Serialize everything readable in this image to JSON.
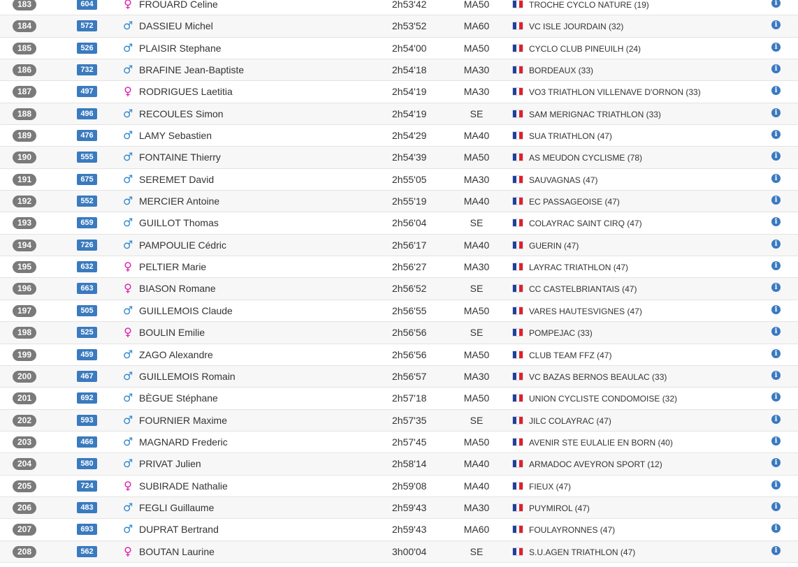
{
  "colors": {
    "rank_badge": "#7a7a7a",
    "bib_badge": "#3a7abf",
    "male_icon": "#2f87cf",
    "female_icon": "#e01aa8",
    "info_icon": "#3a7abf",
    "flag_blue": "#1f3fa0",
    "flag_white": "#ffffff",
    "flag_red": "#e0202c"
  },
  "icons": {
    "male": "male-icon",
    "female": "female-icon",
    "flag": "french-flag-icon",
    "info": "info-icon"
  },
  "results": [
    {
      "rank": "183",
      "bib": "604",
      "sex": "F",
      "name": "FROUARD Celine",
      "time": "2h53'42",
      "category": "MA50",
      "club": "TROCHE CYCLO NATURE (19)"
    },
    {
      "rank": "184",
      "bib": "572",
      "sex": "M",
      "name": "DASSIEU Michel",
      "time": "2h53'52",
      "category": "MA60",
      "club": "VC ISLE JOURDAIN (32)"
    },
    {
      "rank": "185",
      "bib": "526",
      "sex": "M",
      "name": "PLAISIR Stephane",
      "time": "2h54'00",
      "category": "MA50",
      "club": "CYCLO CLUB PINEUILH (24)"
    },
    {
      "rank": "186",
      "bib": "732",
      "sex": "M",
      "name": "BRAFINE Jean-Baptiste",
      "time": "2h54'18",
      "category": "MA30",
      "club": "BORDEAUX (33)"
    },
    {
      "rank": "187",
      "bib": "497",
      "sex": "F",
      "name": "RODRIGUES Laetitia",
      "time": "2h54'19",
      "category": "MA30",
      "club": "VO3 TRIATHLON VILLENAVE D'ORNON (33)"
    },
    {
      "rank": "188",
      "bib": "496",
      "sex": "M",
      "name": "RECOULES Simon",
      "time": "2h54'19",
      "category": "SE",
      "club": "SAM MERIGNAC TRIATHLON (33)"
    },
    {
      "rank": "189",
      "bib": "476",
      "sex": "M",
      "name": "LAMY Sebastien",
      "time": "2h54'29",
      "category": "MA40",
      "club": "SUA TRIATHLON (47)"
    },
    {
      "rank": "190",
      "bib": "555",
      "sex": "M",
      "name": "FONTAINE Thierry",
      "time": "2h54'39",
      "category": "MA50",
      "club": "AS MEUDON CYCLISME (78)"
    },
    {
      "rank": "191",
      "bib": "675",
      "sex": "M",
      "name": "SEREMET David",
      "time": "2h55'05",
      "category": "MA30",
      "club": "SAUVAGNAS (47)"
    },
    {
      "rank": "192",
      "bib": "552",
      "sex": "M",
      "name": "MERCIER Antoine",
      "time": "2h55'19",
      "category": "MA40",
      "club": "EC PASSAGEOISE (47)"
    },
    {
      "rank": "193",
      "bib": "659",
      "sex": "M",
      "name": "GUILLOT Thomas",
      "time": "2h56'04",
      "category": "SE",
      "club": "COLAYRAC SAINT CIRQ (47)"
    },
    {
      "rank": "194",
      "bib": "726",
      "sex": "M",
      "name": "PAMPOULIE Cédric",
      "time": "2h56'17",
      "category": "MA40",
      "club": "GUERIN (47)"
    },
    {
      "rank": "195",
      "bib": "632",
      "sex": "F",
      "name": "PELTIER Marie",
      "time": "2h56'27",
      "category": "MA30",
      "club": "LAYRAC TRIATHLON (47)"
    },
    {
      "rank": "196",
      "bib": "663",
      "sex": "F",
      "name": "BIASON Romane",
      "time": "2h56'52",
      "category": "SE",
      "club": "CC CASTELBRIANTAIS (47)"
    },
    {
      "rank": "197",
      "bib": "505",
      "sex": "M",
      "name": "GUILLEMOIS Claude",
      "time": "2h56'55",
      "category": "MA50",
      "club": "VARES HAUTESVIGNES (47)"
    },
    {
      "rank": "198",
      "bib": "525",
      "sex": "F",
      "name": "BOULIN Emilie",
      "time": "2h56'56",
      "category": "SE",
      "club": "POMPEJAC (33)"
    },
    {
      "rank": "199",
      "bib": "459",
      "sex": "M",
      "name": "ZAGO Alexandre",
      "time": "2h56'56",
      "category": "MA50",
      "club": "CLUB TEAM FFZ (47)"
    },
    {
      "rank": "200",
      "bib": "467",
      "sex": "M",
      "name": "GUILLEMOIS Romain",
      "time": "2h56'57",
      "category": "MA30",
      "club": "VC BAZAS BERNOS BEAULAC (33)"
    },
    {
      "rank": "201",
      "bib": "692",
      "sex": "M",
      "name": "BÈGUE Stéphane",
      "time": "2h57'18",
      "category": "MA50",
      "club": "UNION CYCLISTE CONDOMOISE (32)"
    },
    {
      "rank": "202",
      "bib": "593",
      "sex": "M",
      "name": "FOURNIER Maxime",
      "time": "2h57'35",
      "category": "SE",
      "club": "JILC COLAYRAC (47)"
    },
    {
      "rank": "203",
      "bib": "466",
      "sex": "M",
      "name": "MAGNARD Frederic",
      "time": "2h57'45",
      "category": "MA50",
      "club": "AVENIR STE EULALIE EN BORN (40)"
    },
    {
      "rank": "204",
      "bib": "580",
      "sex": "M",
      "name": "PRIVAT Julien",
      "time": "2h58'14",
      "category": "MA40",
      "club": "ARMADOC AVEYRON SPORT (12)"
    },
    {
      "rank": "205",
      "bib": "724",
      "sex": "F",
      "name": "SUBIRADE Nathalie",
      "time": "2h59'08",
      "category": "MA40",
      "club": "FIEUX (47)"
    },
    {
      "rank": "206",
      "bib": "483",
      "sex": "M",
      "name": "FEGLI Guillaume",
      "time": "2h59'43",
      "category": "MA30",
      "club": "PUYMIROL (47)"
    },
    {
      "rank": "207",
      "bib": "693",
      "sex": "M",
      "name": "DUPRAT Bertrand",
      "time": "2h59'43",
      "category": "MA60",
      "club": "FOULAYRONNES (47)"
    },
    {
      "rank": "208",
      "bib": "562",
      "sex": "F",
      "name": "BOUTAN Laurine",
      "time": "3h00'04",
      "category": "SE",
      "club": "S.U.AGEN TRIATHLON (47)"
    }
  ]
}
